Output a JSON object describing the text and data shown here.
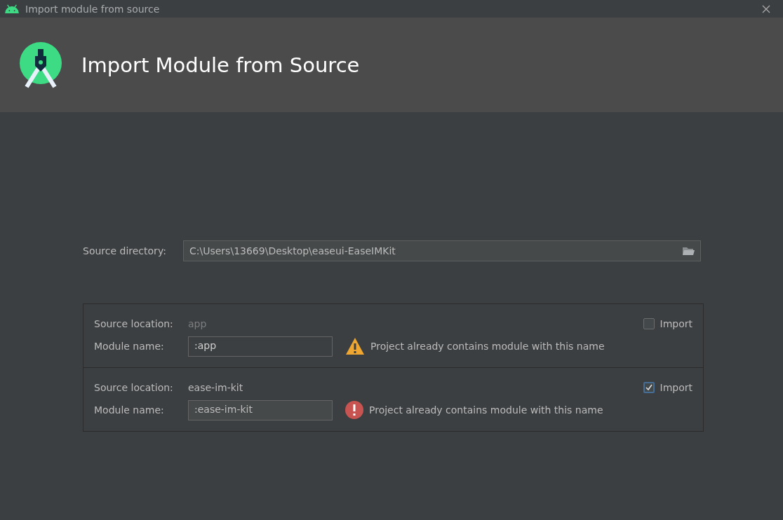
{
  "window": {
    "title": "Import module from source"
  },
  "header": {
    "title": "Import Module from Source"
  },
  "source_directory": {
    "label": "Source directory:",
    "value": "C:\\Users\\13669\\Desktop\\easeui-EaseIMKit"
  },
  "modules": [
    {
      "location_label": "Source location:",
      "location": "app",
      "import_label": "Import",
      "checked": false,
      "name_label": "Module name:",
      "name": ":app",
      "kind": "warning",
      "message": "Project already contains module with this name"
    },
    {
      "location_label": "Source location:",
      "location": "ease-im-kit",
      "import_label": "Import",
      "checked": true,
      "name_label": "Module name:",
      "name": ":ease-im-kit",
      "kind": "error",
      "message": "Project already contains module with this name"
    }
  ]
}
